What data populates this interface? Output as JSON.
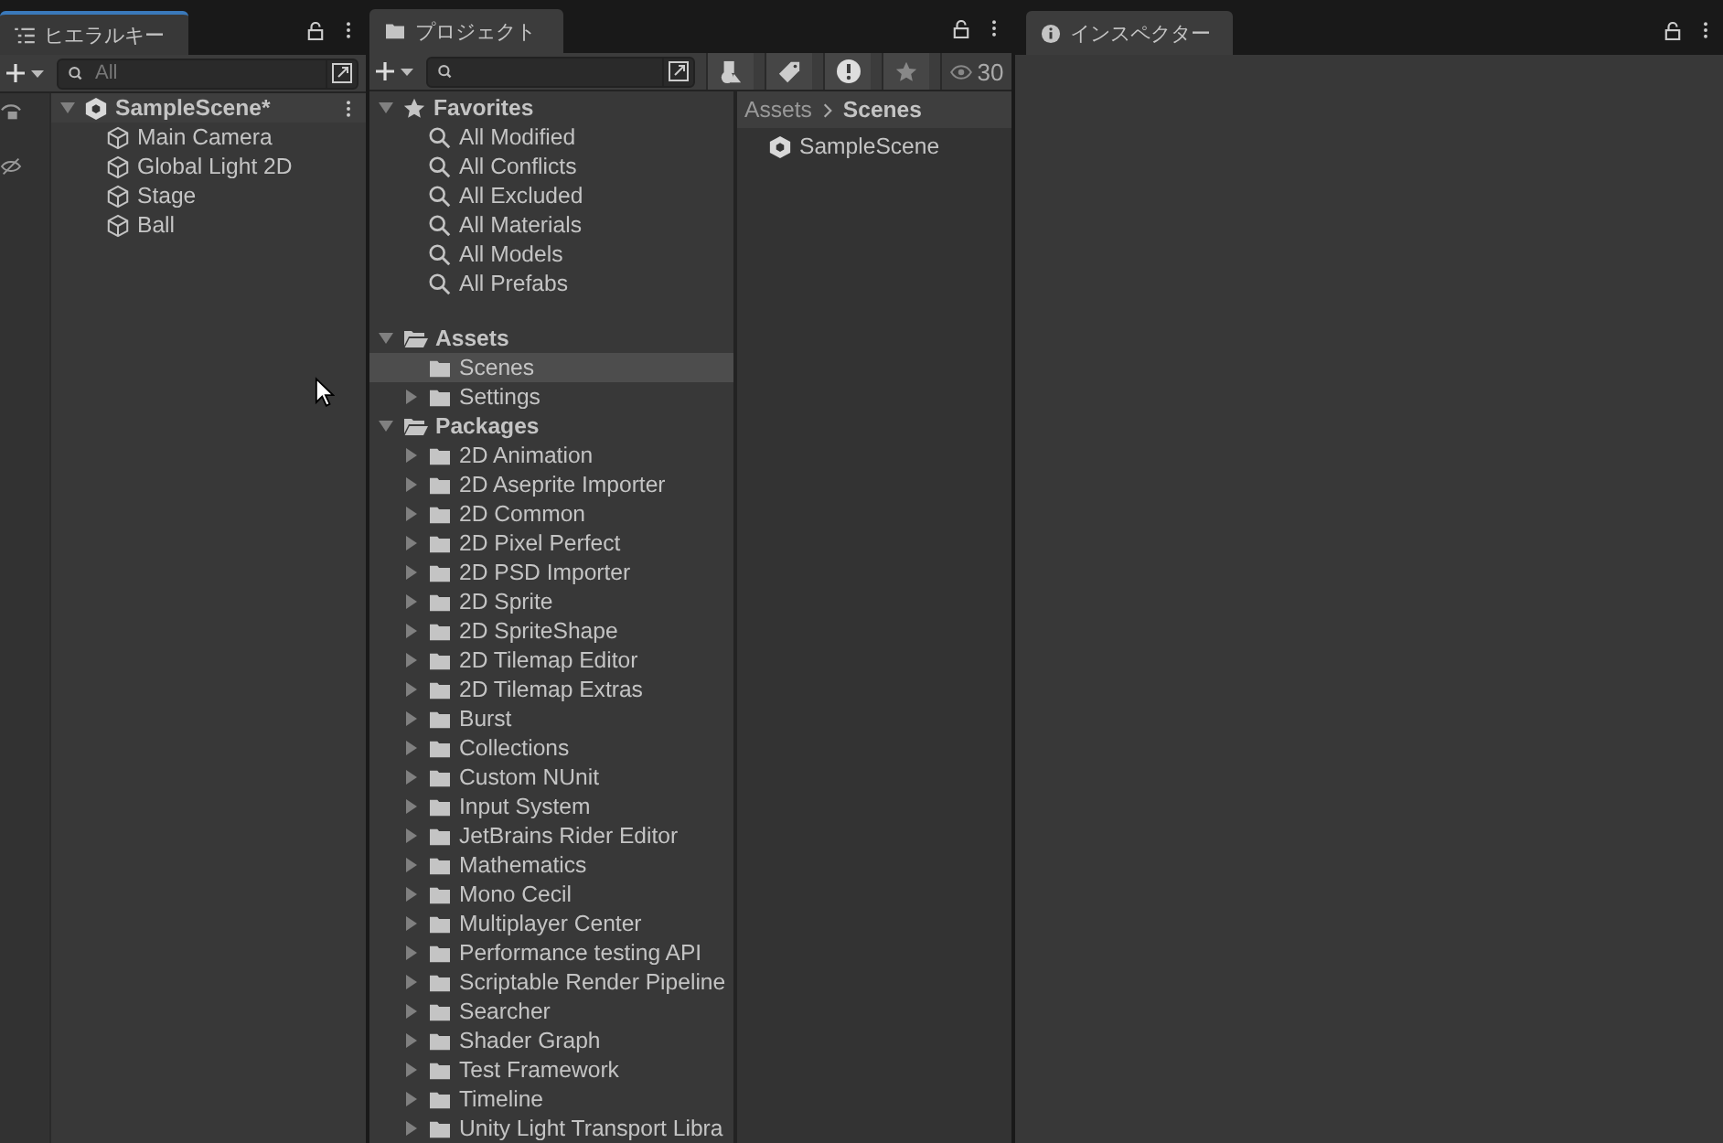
{
  "hierarchy": {
    "tab": {
      "label": "ヒエラルキー",
      "selected": true
    },
    "search": {
      "placeholder": "All"
    },
    "scene": {
      "label": "SampleScene*",
      "expanded": true,
      "children": [
        {
          "label": "Main Camera"
        },
        {
          "label": "Global Light 2D"
        },
        {
          "label": "Stage"
        },
        {
          "label": "Ball"
        }
      ]
    }
  },
  "project": {
    "tab": {
      "label": "プロジェクト",
      "selected": false
    },
    "hidden_count": "30",
    "tree": [
      {
        "label": "Favorites",
        "kind": "favorites",
        "expanded": true,
        "selected": false,
        "children": [
          {
            "label": "All Modified",
            "kind": "search",
            "selected": false
          },
          {
            "label": "All Conflicts",
            "kind": "search",
            "selected": false
          },
          {
            "label": "All Excluded",
            "kind": "search",
            "selected": false
          },
          {
            "label": "All Materials",
            "kind": "search",
            "selected": false
          },
          {
            "label": "All Models",
            "kind": "search",
            "selected": false
          },
          {
            "label": "All Prefabs",
            "kind": "search",
            "selected": false
          }
        ]
      },
      {
        "label": "Assets",
        "kind": "folder",
        "expanded": true,
        "selected": false,
        "children": [
          {
            "label": "Scenes",
            "kind": "folder",
            "selected": true
          },
          {
            "label": "Settings",
            "kind": "folder",
            "expanded": false,
            "selected": false
          }
        ]
      },
      {
        "label": "Packages",
        "kind": "folder",
        "expanded": true,
        "selected": false,
        "children": [
          {
            "label": "2D Animation",
            "kind": "folder",
            "expanded": false,
            "selected": false
          },
          {
            "label": "2D Aseprite Importer",
            "kind": "folder",
            "expanded": false,
            "selected": false
          },
          {
            "label": "2D Common",
            "kind": "folder",
            "expanded": false,
            "selected": false
          },
          {
            "label": "2D Pixel Perfect",
            "kind": "folder",
            "expanded": false,
            "selected": false
          },
          {
            "label": "2D PSD Importer",
            "kind": "folder",
            "expanded": false,
            "selected": false
          },
          {
            "label": "2D Sprite",
            "kind": "folder",
            "expanded": false,
            "selected": false
          },
          {
            "label": "2D SpriteShape",
            "kind": "folder",
            "expanded": false,
            "selected": false
          },
          {
            "label": "2D Tilemap Editor",
            "kind": "folder",
            "expanded": false,
            "selected": false
          },
          {
            "label": "2D Tilemap Extras",
            "kind": "folder",
            "expanded": false,
            "selected": false
          },
          {
            "label": "Burst",
            "kind": "folder",
            "expanded": false,
            "selected": false
          },
          {
            "label": "Collections",
            "kind": "folder",
            "expanded": false,
            "selected": false
          },
          {
            "label": "Custom NUnit",
            "kind": "folder",
            "expanded": false,
            "selected": false
          },
          {
            "label": "Input System",
            "kind": "folder",
            "expanded": false,
            "selected": false
          },
          {
            "label": "JetBrains Rider Editor",
            "kind": "folder",
            "expanded": false,
            "selected": false
          },
          {
            "label": "Mathematics",
            "kind": "folder",
            "expanded": false,
            "selected": false
          },
          {
            "label": "Mono Cecil",
            "kind": "folder",
            "expanded": false,
            "selected": false
          },
          {
            "label": "Multiplayer Center",
            "kind": "folder",
            "expanded": false,
            "selected": false
          },
          {
            "label": "Performance testing API",
            "kind": "folder",
            "expanded": false,
            "selected": false
          },
          {
            "label": "Scriptable Render Pipeline",
            "kind": "folder",
            "expanded": false,
            "selected": false
          },
          {
            "label": "Searcher",
            "kind": "folder",
            "expanded": false,
            "selected": false
          },
          {
            "label": "Shader Graph",
            "kind": "folder",
            "expanded": false,
            "selected": false
          },
          {
            "label": "Test Framework",
            "kind": "folder",
            "expanded": false,
            "selected": false
          },
          {
            "label": "Timeline",
            "kind": "folder",
            "expanded": false,
            "selected": false
          },
          {
            "label": "Unity Light Transport Libra",
            "kind": "folder",
            "expanded": false,
            "selected": false
          }
        ]
      }
    ],
    "breadcrumb": [
      "Assets",
      "Scenes"
    ],
    "files": [
      {
        "label": "SampleScene",
        "kind": "scene"
      }
    ]
  },
  "inspector": {
    "tab": {
      "label": "インスペクター",
      "selected": false
    }
  }
}
